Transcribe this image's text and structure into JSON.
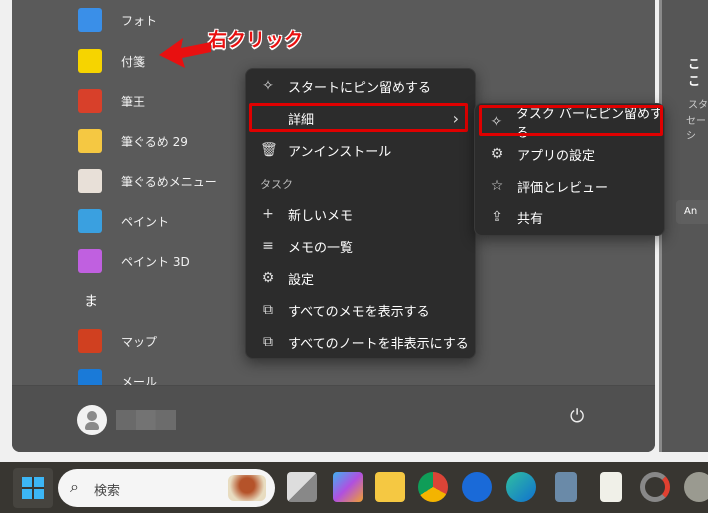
{
  "annotation": "右クリック",
  "apps": [
    {
      "label": "フォト",
      "icon": "photos-icon",
      "color": "#3a8fe8"
    },
    {
      "label": "付箋",
      "icon": "sticky-notes-icon",
      "color": "#f6d400"
    },
    {
      "label": "筆王",
      "icon": "fudeoh-icon",
      "color": "#d8402a"
    },
    {
      "label": "筆ぐるめ 29",
      "icon": "folder-icon",
      "color": "#f5c842"
    },
    {
      "label": "筆ぐるめメニュー",
      "icon": "fudegurume-menu-icon",
      "color": "#e8e0d8"
    },
    {
      "label": "ペイント",
      "icon": "paint-icon",
      "color": "#3aa0e0"
    },
    {
      "label": "ペイント 3D",
      "icon": "paint-3d-icon",
      "color": "#c060e0"
    },
    {
      "label": "マップ",
      "icon": "maps-icon",
      "color": "#d04020"
    },
    {
      "label": "メール",
      "icon": "mail-icon",
      "color": "#1a7ad8"
    }
  ],
  "section_letter": "ま",
  "context_menu": {
    "items": [
      {
        "label": "スタートにピン留めする",
        "icon": "pin-icon",
        "glyph": "✧"
      },
      {
        "label": "詳細",
        "icon": "",
        "glyph": ""
      },
      {
        "label": "アンインストール",
        "icon": "trash-icon",
        "glyph": "🗑"
      }
    ],
    "task_header": "タスク",
    "tasks": [
      {
        "label": "新しいメモ",
        "icon": "plus-icon",
        "glyph": "+"
      },
      {
        "label": "メモの一覧",
        "icon": "list-icon",
        "glyph": "≡"
      },
      {
        "label": "設定",
        "icon": "gear-icon",
        "glyph": "⚙"
      },
      {
        "label": "すべてのメモを表示する",
        "icon": "show-all-icon",
        "glyph": "⧉"
      },
      {
        "label": "すべてのノートを非表示にする",
        "icon": "hide-all-icon",
        "glyph": "⧉"
      }
    ],
    "chevron": "›"
  },
  "submenu": {
    "items": [
      {
        "label": "タスク バーにピン留めする",
        "icon": "pin-icon",
        "glyph": "✧"
      },
      {
        "label": "アプリの設定",
        "icon": "gear-icon",
        "glyph": "⚙"
      },
      {
        "label": "評価とレビュー",
        "icon": "star-review-icon",
        "glyph": "☆"
      },
      {
        "label": "共有",
        "icon": "share-icon",
        "glyph": "⇪"
      }
    ]
  },
  "right_panel": {
    "title": "ここ",
    "line1": "スタ",
    "line2": "セーシ",
    "button": "An"
  },
  "power_glyph": "⏻",
  "taskbar": {
    "search_placeholder": "検索"
  }
}
